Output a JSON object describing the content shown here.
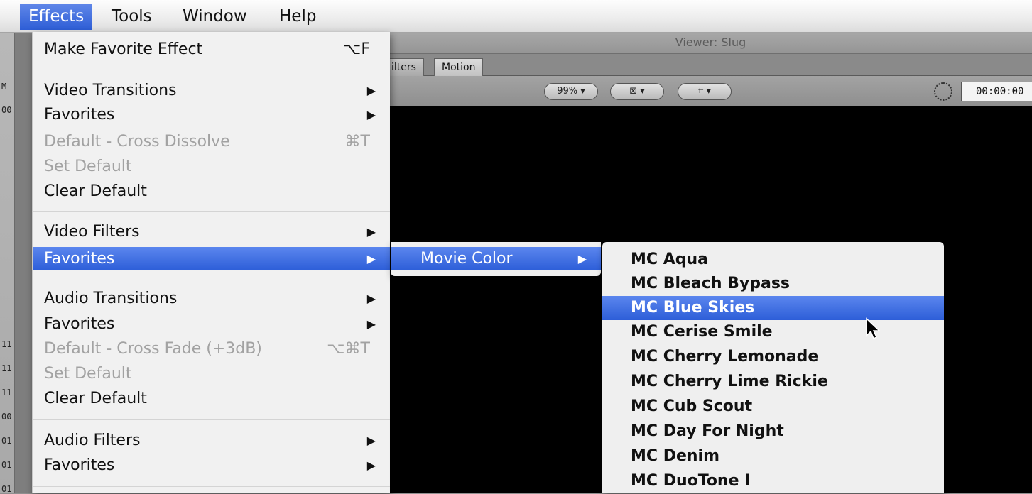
{
  "menubar": {
    "items": [
      "Effects",
      "Tools",
      "Window",
      "Help"
    ]
  },
  "viewer": {
    "title": "Viewer: Slug",
    "tabs": [
      "ilters",
      "Motion"
    ],
    "zoom": "99%",
    "timecode": "00:00:00"
  },
  "browser_strip": {
    "labels": [
      "M",
      "00",
      "11",
      "11",
      "11",
      "00",
      "01",
      "01",
      "01"
    ]
  },
  "effects_menu": {
    "make_favorite": {
      "label": "Make Favorite Effect",
      "shortcut": "⌥F"
    },
    "video_transitions": {
      "label": "Video Transitions"
    },
    "video_transitions_favorites": {
      "label": "Favorites"
    },
    "video_default": {
      "label": "Default - Cross Dissolve",
      "shortcut": "⌘T"
    },
    "video_set_default": {
      "label": "Set Default"
    },
    "video_clear_default": {
      "label": "Clear Default"
    },
    "video_filters": {
      "label": "Video Filters"
    },
    "video_filters_favorites": {
      "label": "Favorites"
    },
    "audio_transitions": {
      "label": "Audio Transitions"
    },
    "audio_transitions_favorites": {
      "label": "Favorites"
    },
    "audio_default": {
      "label": "Default - Cross Fade (+3dB)",
      "shortcut": "⌥⌘T"
    },
    "audio_set_default": {
      "label": "Set Default"
    },
    "audio_clear_default": {
      "label": "Clear Default"
    },
    "audio_filters": {
      "label": "Audio Filters"
    },
    "audio_filters_favorites": {
      "label": "Favorites"
    }
  },
  "favorites_submenu": {
    "items": [
      "Movie Color"
    ]
  },
  "movie_color_submenu": {
    "items": [
      "MC Aqua",
      "MC Bleach Bypass",
      "MC Blue Skies",
      "MC Cerise Smile",
      "MC Cherry Lemonade",
      "MC Cherry Lime Rickie",
      "MC Cub Scout",
      "MC Day For Night",
      "MC Denim",
      "MC DuoTone I"
    ],
    "highlighted": "MC Blue Skies"
  },
  "colors": {
    "selection": "#2d5ed8",
    "menu_bg": "#f3f3f3",
    "disabled_text": "#a2a2a2"
  }
}
